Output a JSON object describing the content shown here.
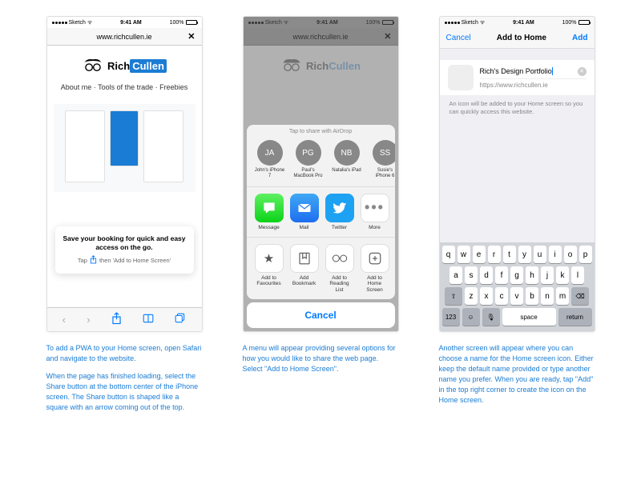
{
  "status": {
    "carrier": "Sketch",
    "time": "9:41 AM",
    "battery": "100%"
  },
  "url": "www.richcullen.ie",
  "logo": {
    "rich": "Rich",
    "cullen": "Cullen"
  },
  "nav": "About me · Tools of the trade · Freebies",
  "callout": {
    "title": "Save your booking for quick and easy access on the go.",
    "sub_pre": "Tap",
    "sub_post": "then 'Add to Home Screen'"
  },
  "sheet": {
    "airdrop_hint": "Tap to share with AirDrop",
    "contacts": [
      {
        "initials": "JA",
        "name": "John's iPhone 7"
      },
      {
        "initials": "PG",
        "name": "Paul's MacBook Pro"
      },
      {
        "initials": "NB",
        "name": "Natalia's iPad"
      },
      {
        "initials": "SS",
        "name": "Susie's iPhone 6"
      }
    ],
    "apps": [
      {
        "label": "Message"
      },
      {
        "label": "Mail"
      },
      {
        "label": "Twitter"
      },
      {
        "label": "More"
      }
    ],
    "actions": [
      {
        "label": "Add to Favourites"
      },
      {
        "label": "Add Bookmark"
      },
      {
        "label": "Add to Reading List"
      },
      {
        "label": "Add to Home Screen"
      }
    ],
    "cancel": "Cancel"
  },
  "add_home": {
    "cancel": "Cancel",
    "title": "Add to Home",
    "add": "Add",
    "name_value": "Rich's Design Portfolio",
    "url_value": "https://www.richcullen.ie",
    "hint": "An icon will be added to your Home screen so you can quickly access this website."
  },
  "keyboard": {
    "row1": [
      "q",
      "w",
      "e",
      "r",
      "t",
      "y",
      "u",
      "i",
      "o",
      "p"
    ],
    "row2": [
      "a",
      "s",
      "d",
      "f",
      "g",
      "h",
      "j",
      "k",
      "l"
    ],
    "row3": [
      "z",
      "x",
      "c",
      "v",
      "b",
      "n",
      "m"
    ],
    "shift": "⇧",
    "del": "⌫",
    "num": "123",
    "emoji": "😀",
    "mic": "🎤",
    "space": "space",
    "return": "return"
  },
  "captions": {
    "c1a": "To add a PWA to your Home screen, open Safari and navigate to the website.",
    "c1b": "When the page has finished loading, select the Share button at the bottom center of the iPhone screen. The Share button is shaped like a square with an arrow coming out of the top.",
    "c2": "A menu will appear providing several options for how you would like to share the web page. Select \"Add to Home Screen\".",
    "c3": "Another screen will appear where you can choose a name for the Home screen icon. Either keep the default name provided or type another name you prefer. When you are ready, tap \"Add\" in the top right corner to create the icon on the Home screen."
  }
}
